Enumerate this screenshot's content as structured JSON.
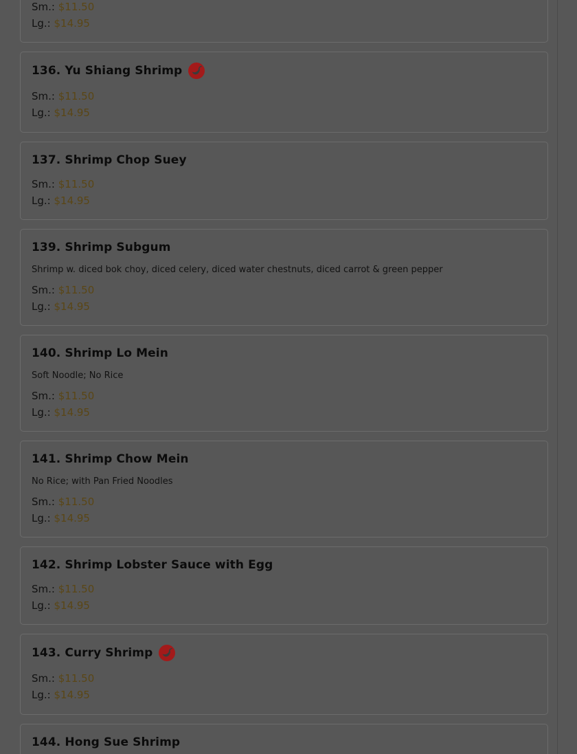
{
  "items": [
    {
      "sm_label": "Sm.:",
      "sm_price": "$11.50",
      "lg_label": "Lg.:",
      "lg_price": "$14.95"
    },
    {
      "title": "136. Yu Shiang Shrimp",
      "spicy_icon": "chili-pepper-icon",
      "sm_label": "Sm.:",
      "sm_price": "$11.50",
      "lg_label": "Lg.:",
      "lg_price": "$14.95"
    },
    {
      "title": "137. Shrimp Chop Suey",
      "sm_label": "Sm.:",
      "sm_price": "$11.50",
      "lg_label": "Lg.:",
      "lg_price": "$14.95"
    },
    {
      "title": "139. Shrimp Subgum",
      "description": "Shrimp w. diced bok choy, diced celery, diced water chestnuts, diced carrot & green pepper",
      "sm_label": "Sm.:",
      "sm_price": "$11.50",
      "lg_label": "Lg.:",
      "lg_price": "$14.95"
    },
    {
      "title": "140. Shrimp Lo Mein",
      "description": "Soft Noodle; No Rice",
      "sm_label": "Sm.:",
      "sm_price": "$11.50",
      "lg_label": "Lg.:",
      "lg_price": "$14.95"
    },
    {
      "title": "141. Shrimp Chow Mein",
      "description": "No Rice; with Pan Fried Noodles",
      "sm_label": "Sm.:",
      "sm_price": "$11.50",
      "lg_label": "Lg.:",
      "lg_price": "$14.95"
    },
    {
      "title": "142. Shrimp Lobster Sauce with Egg",
      "sm_label": "Sm.:",
      "sm_price": "$11.50",
      "lg_label": "Lg.:",
      "lg_price": "$14.95"
    },
    {
      "title": "143. Curry Shrimp",
      "spicy_icon": "chili-pepper-icon",
      "sm_label": "Sm.:",
      "sm_price": "$11.50",
      "lg_label": "Lg.:",
      "lg_price": "$14.95"
    },
    {
      "title": "144. Hong Sue Shrimp"
    }
  ],
  "colors": {
    "overlay_background": "#575757",
    "price": "#5a4615",
    "spicy_icon": "#a31a1a"
  }
}
